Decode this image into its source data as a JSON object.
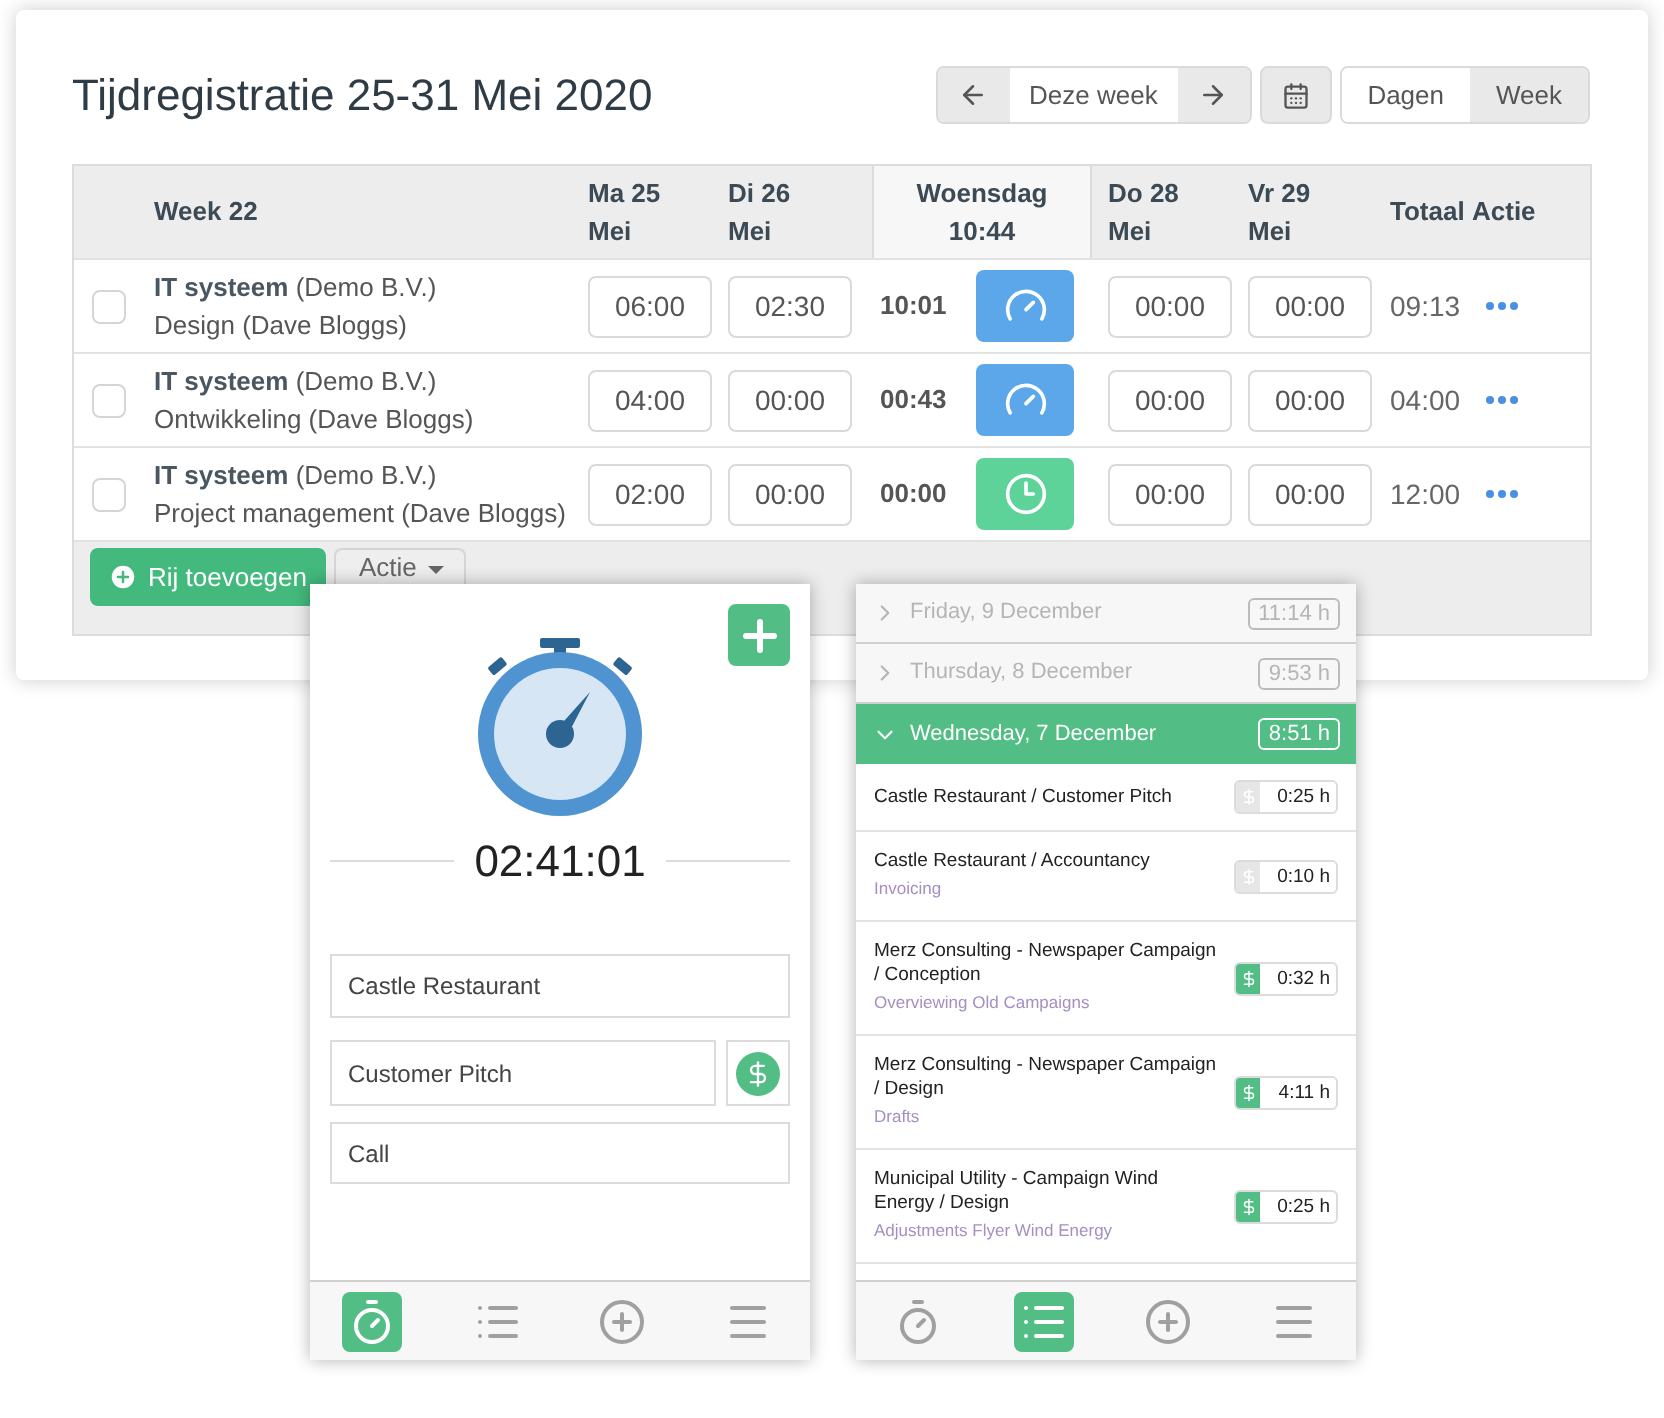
{
  "timesheet": {
    "title": "Tijdregistratie 25-31 Mei 2020",
    "period": "Deze week",
    "views": [
      {
        "label": "Dagen",
        "selected": false
      },
      {
        "label": "Week",
        "selected": true
      }
    ],
    "week_label": "Week 22",
    "columns": [
      {
        "kind": "day",
        "line1": "Ma 25",
        "line2": "Mei"
      },
      {
        "kind": "day",
        "line1": "Di 26",
        "line2": "Mei"
      },
      {
        "kind": "today",
        "line1": "Woensdag",
        "line2": "10:44"
      },
      {
        "kind": "day",
        "line1": "Do 28",
        "line2": "Mei"
      },
      {
        "kind": "day",
        "line1": "Vr 29",
        "line2": "Mei"
      }
    ],
    "total_label": "Totaal",
    "action_label": "Actie",
    "rows": [
      {
        "project": "IT systeem",
        "client": "(Demo B.V.)",
        "task": "Design (Dave Bloggs)",
        "checked": false,
        "cells": [
          "06:00",
          "02:30",
          "10:01",
          "00:00",
          "00:00"
        ],
        "running": true,
        "total": "09:13"
      },
      {
        "project": "IT systeem",
        "client": "(Demo B.V.)",
        "task": "Ontwikkeling (Dave Bloggs)",
        "checked": false,
        "cells": [
          "04:00",
          "00:00",
          "00:43",
          "00:00",
          "00:00"
        ],
        "running": true,
        "total": "04:00"
      },
      {
        "project": "IT systeem",
        "client": "(Demo B.V.)",
        "task": "Project management (Dave Bloggs)",
        "checked": false,
        "cells": [
          "02:00",
          "00:00",
          "00:00",
          "00:00",
          "00:00"
        ],
        "running": false,
        "total": "12:00"
      }
    ],
    "add_button": "Rij toevoegen",
    "action_dropdown": "Actie"
  },
  "timer_app": {
    "elapsed": "02:41:01",
    "client": "Castle Restaurant",
    "task": "Customer Pitch",
    "billable": true,
    "note": "Call",
    "nav": [
      {
        "kind": "timer",
        "selected": true
      },
      {
        "kind": "list",
        "selected": false
      },
      {
        "kind": "add",
        "selected": false
      },
      {
        "kind": "menu",
        "selected": false
      }
    ]
  },
  "list_app": {
    "days": [
      {
        "label": "Friday, 9 December",
        "hours": "11:14 h",
        "expanded": false
      },
      {
        "label": "Thursday, 8 December",
        "hours": "9:53 h",
        "expanded": false
      },
      {
        "label": "Wednesday, 7 December",
        "hours": "8:51 h",
        "expanded": true
      }
    ],
    "entries": [
      {
        "title": "Castle Restaurant / Customer Pitch",
        "billable": false,
        "duration": "0:25 h"
      },
      {
        "title": "Castle Restaurant / Accountancy",
        "subtitle": "Invoicing",
        "billable": false,
        "duration": "0:10 h"
      },
      {
        "title": "Merz Consulting - Newspaper Campaign / Conception",
        "subtitle": "Overviewing Old Campaigns",
        "billable": true,
        "duration": "0:32 h"
      },
      {
        "title": "Merz Consulting - Newspaper Campaign / Design",
        "subtitle": "Drafts",
        "billable": true,
        "duration": "4:11 h"
      },
      {
        "title": "Municipal Utility - Campaign Wind Energy / Design",
        "subtitle": "Adjustments Flyer Wind Energy",
        "billable": true,
        "duration": "0:25 h"
      }
    ],
    "nav": [
      {
        "kind": "timer",
        "selected": false
      },
      {
        "kind": "list",
        "selected": true
      },
      {
        "kind": "add",
        "selected": false
      },
      {
        "kind": "menu",
        "selected": false
      }
    ]
  }
}
